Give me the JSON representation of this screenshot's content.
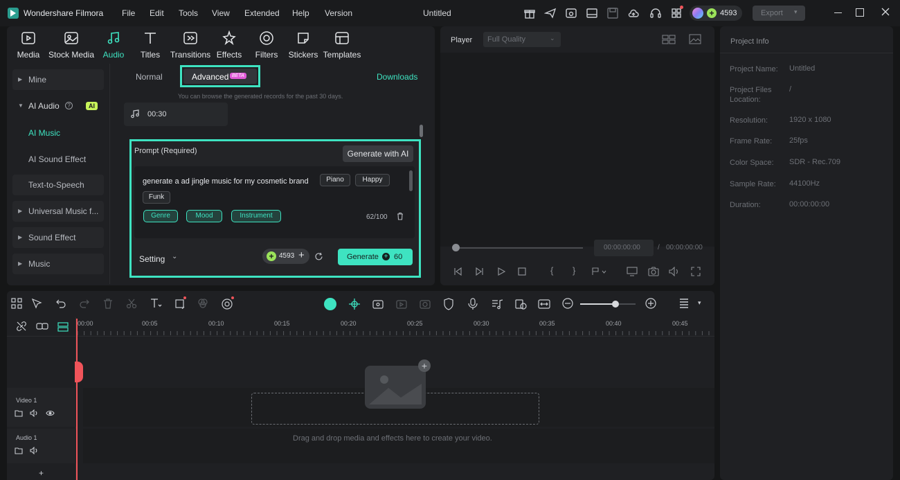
{
  "app": {
    "name": "Wondershare Filmora",
    "document_title": "Untitled",
    "menu": [
      "File",
      "Edit",
      "Tools",
      "View",
      "Extended",
      "Help",
      "Version"
    ],
    "credits": "4593",
    "export_label": "Export"
  },
  "toolbar_tabs": [
    {
      "label": "Media",
      "icon": "media-icon"
    },
    {
      "label": "Stock Media",
      "icon": "stock-media-icon"
    },
    {
      "label": "Audio",
      "icon": "audio-icon"
    },
    {
      "label": "Titles",
      "icon": "titles-icon"
    },
    {
      "label": "Transitions",
      "icon": "transitions-icon"
    },
    {
      "label": "Effects",
      "icon": "effects-icon"
    },
    {
      "label": "Filters",
      "icon": "filters-icon"
    },
    {
      "label": "Stickers",
      "icon": "stickers-icon"
    },
    {
      "label": "Templates",
      "icon": "templates-icon"
    }
  ],
  "sidebar": {
    "mine": "Mine",
    "ai_audio": "AI Audio",
    "ai_badge": "AI",
    "ai_music": "AI Music",
    "ai_sound_effect": "AI Sound Effect",
    "text_to_speech": "Text-to-Speech",
    "universal_music": "Universal Music f...",
    "sound_effect": "Sound Effect",
    "music": "Music"
  },
  "music_panel": {
    "tab_normal": "Normal",
    "tab_advanced": "Advanced",
    "beta_badge": "BETA",
    "downloads": "Downloads",
    "records_note": "You can browse the generated records for the past 30 days.",
    "record_duration": "00:30",
    "prompt_label": "Prompt (Required)",
    "generate_with_ai": "Generate with AI",
    "prompt_text": "generate a ad jingle music for my cosmetic brand",
    "prompt_chips": [
      "Piano",
      "Happy",
      "Funk"
    ],
    "tag_buttons": [
      "Genre",
      "Mood",
      "Instrument"
    ],
    "char_count": "62/100",
    "setting": "Setting",
    "credits": "4593",
    "generate_label": "Generate",
    "generate_cost": "60"
  },
  "player": {
    "label": "Player",
    "quality": "Full Quality",
    "current_time": "00:00:00:00",
    "separator": "/",
    "total_time": "00:00:00:00"
  },
  "project_info": {
    "title": "Project Info",
    "rows": [
      {
        "label": "Project Name:",
        "value": "Untitled"
      },
      {
        "label": "Project Files Location:",
        "value": "/"
      },
      {
        "label": "Resolution:",
        "value": "1920 x 1080"
      },
      {
        "label": "Frame Rate:",
        "value": "25fps"
      },
      {
        "label": "Color Space:",
        "value": "SDR - Rec.709"
      },
      {
        "label": "Sample Rate:",
        "value": "44100Hz"
      },
      {
        "label": "Duration:",
        "value": "00:00:00:00"
      }
    ]
  },
  "timeline": {
    "ruler": [
      "00:00",
      "00:05",
      "00:10",
      "00:15",
      "00:20",
      "00:25",
      "00:30",
      "00:35",
      "00:40",
      "00:45"
    ],
    "video_track": "Video 1",
    "audio_track": "Audio 1",
    "drop_hint": "Drag and drop media and effects here to create your video.",
    "add_track": "+"
  },
  "colors": {
    "accent": "#3ee3c1",
    "panel": "#1f2023",
    "background": "#151617",
    "playhead": "#f0545a"
  }
}
